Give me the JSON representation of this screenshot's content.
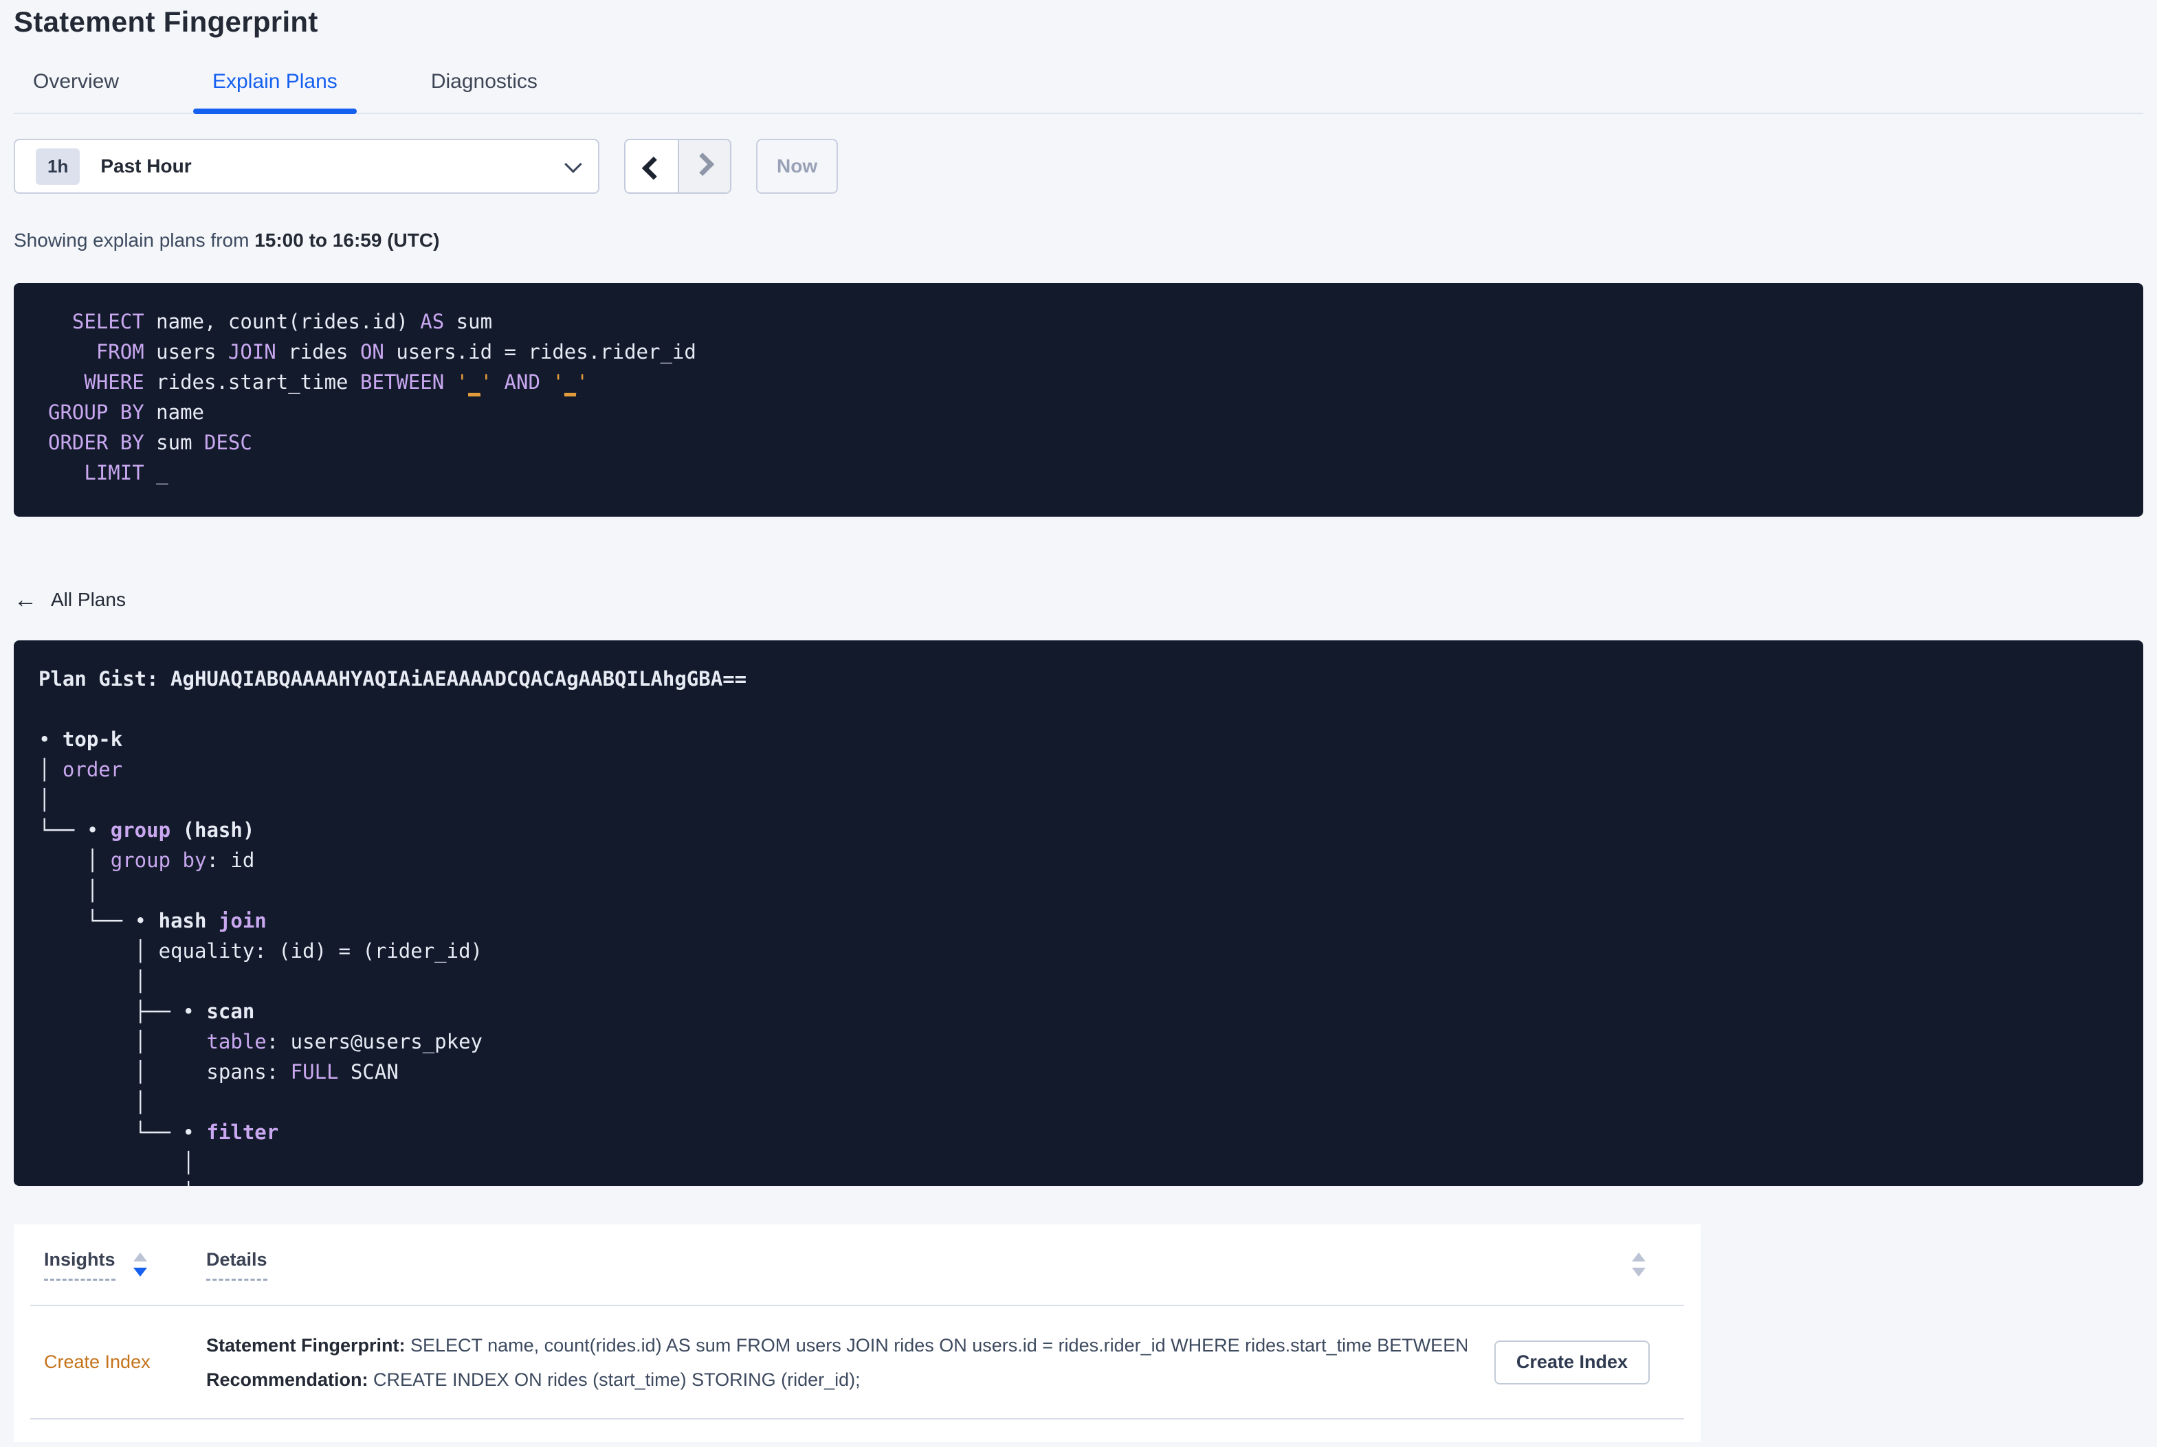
{
  "page": {
    "title": "Statement Fingerprint"
  },
  "tabs": [
    {
      "label": "Overview",
      "active": false
    },
    {
      "label": "Explain Plans",
      "active": true
    },
    {
      "label": "Diagnostics",
      "active": false
    }
  ],
  "time_selector": {
    "badge": "1h",
    "label": "Past Hour"
  },
  "time_nav": {
    "now_label": "Now"
  },
  "showing": {
    "prefix": "Showing explain plans from ",
    "range": "15:00 to 16:59 (UTC)"
  },
  "colors": {
    "accent_blue": "#1660F0",
    "code_background": "#131A2C",
    "keyword_purple": "#C9A8F0",
    "literal_orange": "#E39C3C",
    "insight_orange": "#C4731A"
  },
  "sql": {
    "lines": [
      [
        [
          "p",
          "  "
        ],
        [
          "k",
          "SELECT"
        ],
        [
          "p",
          " name, count(rides.id) "
        ],
        [
          "k",
          "AS"
        ],
        [
          "p",
          " sum"
        ]
      ],
      [
        [
          "p",
          "    "
        ],
        [
          "k",
          "FROM"
        ],
        [
          "p",
          " users "
        ],
        [
          "k",
          "JOIN"
        ],
        [
          "p",
          " rides "
        ],
        [
          "k",
          "ON"
        ],
        [
          "p",
          " users.id = rides.rider_id"
        ]
      ],
      [
        [
          "p",
          "   "
        ],
        [
          "k",
          "WHERE"
        ],
        [
          "p",
          " rides.start_time "
        ],
        [
          "k",
          "BETWEEN"
        ],
        [
          "p",
          " "
        ],
        [
          "o",
          "'"
        ],
        [
          "ou",
          "_"
        ],
        [
          "o",
          "'"
        ],
        [
          "p",
          " "
        ],
        [
          "k",
          "AND"
        ],
        [
          "p",
          " "
        ],
        [
          "o",
          "'"
        ],
        [
          "ou",
          "_"
        ],
        [
          "o",
          "'"
        ]
      ],
      [
        [
          "k",
          "GROUP BY"
        ],
        [
          "p",
          " name"
        ]
      ],
      [
        [
          "k",
          "ORDER BY"
        ],
        [
          "p",
          " sum "
        ],
        [
          "k",
          "DESC"
        ]
      ],
      [
        [
          "p",
          "   "
        ],
        [
          "k",
          "LIMIT"
        ],
        [
          "p",
          " _"
        ]
      ]
    ]
  },
  "all_plans": {
    "label": "All Plans"
  },
  "plan": {
    "lines": [
      [
        [
          "pb",
          "Plan Gist: AgHUAQIABQAAAAHYAQIAiAEAAAADCQACAgAABQILAhgGBA=="
        ]
      ],
      [
        [
          "p",
          ""
        ]
      ],
      [
        [
          "p",
          "• "
        ],
        [
          "pb",
          "top-k"
        ]
      ],
      [
        [
          "p",
          "│ "
        ],
        [
          "k",
          "order"
        ]
      ],
      [
        [
          "p",
          "│"
        ]
      ],
      [
        [
          "p",
          "└── • "
        ],
        [
          "kb",
          "group"
        ],
        [
          "pb",
          " (hash)"
        ]
      ],
      [
        [
          "p",
          "    │ "
        ],
        [
          "k",
          "group by"
        ],
        [
          "p",
          ": id"
        ]
      ],
      [
        [
          "p",
          "    │"
        ]
      ],
      [
        [
          "p",
          "    └── • "
        ],
        [
          "pb",
          "hash "
        ],
        [
          "kb",
          "join"
        ]
      ],
      [
        [
          "p",
          "        │ equality: (id) = (rider_id)"
        ]
      ],
      [
        [
          "p",
          "        │"
        ]
      ],
      [
        [
          "p",
          "        ├── • "
        ],
        [
          "pb",
          "scan"
        ]
      ],
      [
        [
          "p",
          "        │     "
        ],
        [
          "k",
          "table"
        ],
        [
          "p",
          ": users@users_pkey"
        ]
      ],
      [
        [
          "p",
          "        │     spans: "
        ],
        [
          "k",
          "FULL"
        ],
        [
          "p",
          " SCAN"
        ]
      ],
      [
        [
          "p",
          "        │"
        ]
      ],
      [
        [
          "p",
          "        └── • "
        ],
        [
          "kb",
          "filter"
        ]
      ],
      [
        [
          "p",
          "            │"
        ]
      ],
      [
        [
          "p",
          "            │"
        ]
      ]
    ]
  },
  "table": {
    "col_insights": "Insights",
    "col_details": "Details",
    "row": {
      "insight": "Create Index",
      "d1_label": "Statement Fingerprint:",
      "d1_text": " SELECT name, count(rides.id) AS sum FROM users JOIN rides ON users.id = rides.rider_id WHERE rides.start_time BETWEEN '_…",
      "d2_label": "Recommendation:",
      "d2_text": " CREATE INDEX ON rides (start_time) STORING (rider_id);",
      "button_label": "Create Index"
    }
  }
}
